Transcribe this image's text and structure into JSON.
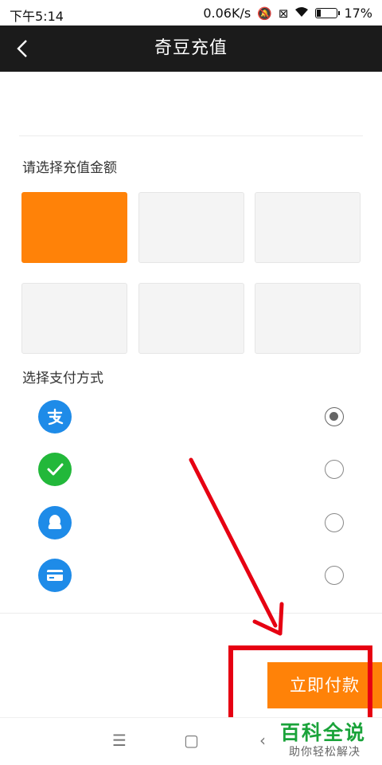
{
  "status_bar": {
    "time": "下午5:14",
    "network_speed": "0.06K/s",
    "battery_percent": "17%"
  },
  "header": {
    "title": "奇豆充值",
    "back_icon": "chevron-left-icon"
  },
  "amount_section": {
    "label": "请选择充值金额",
    "options": [
      {
        "selected": true
      },
      {
        "selected": false
      },
      {
        "selected": false
      },
      {
        "selected": false
      },
      {
        "selected": false
      },
      {
        "selected": false
      }
    ]
  },
  "payment_section": {
    "label": "选择支付方式",
    "methods": [
      {
        "icon": "alipay-icon",
        "color": "#1e8be8",
        "selected": true
      },
      {
        "icon": "wechat-pay-icon",
        "color": "#22b83a",
        "selected": false
      },
      {
        "icon": "qq-wallet-icon",
        "color": "#1e8be8",
        "selected": false
      },
      {
        "icon": "bank-card-icon",
        "color": "#1e8be8",
        "selected": false
      }
    ]
  },
  "pay_button": {
    "label": "立即付款",
    "color": "#ff8208"
  },
  "annotation": {
    "color": "#e60012"
  },
  "system_nav": {
    "menu_icon": "menu-icon",
    "home_icon": "home-square-icon",
    "back_icon": "back-triangle-icon"
  },
  "watermark": {
    "title": "百科全说",
    "subtitle": "助你轻松解决"
  }
}
